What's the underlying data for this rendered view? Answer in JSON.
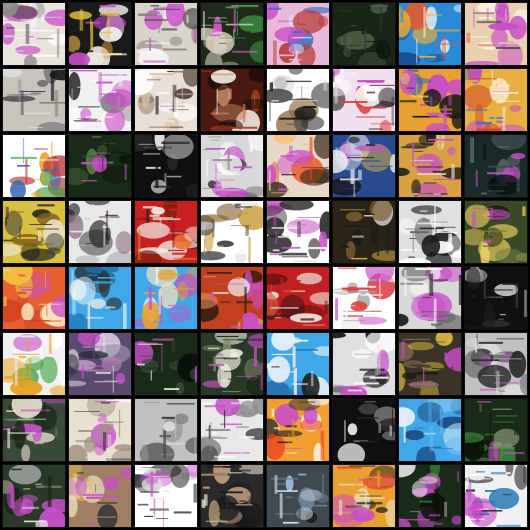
{
  "image_grid": {
    "rows": 8,
    "columns": 8,
    "tiles": [
      {
        "palette": [
          "#e8e4dc",
          "#c84ec8",
          "#2b2b2b",
          "#8c8c8c",
          "#ffffff"
        ],
        "style": "doc"
      },
      {
        "palette": [
          "#1a1a1a",
          "#e6c23a",
          "#c84ec8",
          "#d9a040",
          "#f2f2f2"
        ],
        "style": "burst"
      },
      {
        "palette": [
          "#d8d4cc",
          "#c84ec8",
          "#3a3a3a",
          "#8a8070",
          "#f5f5f5"
        ],
        "style": "doc"
      },
      {
        "palette": [
          "#1f2a1a",
          "#e85ad8",
          "#40a048",
          "#d8d0c0",
          "#a0a090"
        ],
        "style": "doc"
      },
      {
        "palette": [
          "#e8b8d8",
          "#c84ec8",
          "#3a70c0",
          "#e0e0f0",
          "#b84040"
        ],
        "style": "burst"
      },
      {
        "palette": [
          "#1a2418",
          "#2a3a28",
          "#3a4a38",
          "#101810",
          "#506048"
        ],
        "style": "dark"
      },
      {
        "palette": [
          "#2a8ad8",
          "#e85a2a",
          "#ffffff",
          "#f0b030",
          "#1a4a90"
        ],
        "style": "sky"
      },
      {
        "palette": [
          "#e8d0b0",
          "#c84ec8",
          "#e86030",
          "#3a3a3a",
          "#f8f0e0"
        ],
        "style": "burst"
      },
      {
        "palette": [
          "#c8c4bc",
          "#1a1a1a",
          "#8a8a8a",
          "#e0e0e0",
          "#505050"
        ],
        "style": "dark"
      },
      {
        "palette": [
          "#f0f0f0",
          "#2a2a2a",
          "#c84ec8",
          "#a0a0a0",
          "#ffffff"
        ],
        "style": "doc"
      },
      {
        "palette": [
          "#e8e0d8",
          "#3a2a2a",
          "#d8c0a0",
          "#8a7060",
          "#ffffff"
        ],
        "style": "doc"
      },
      {
        "palette": [
          "#4a1a10",
          "#f0e8e0",
          "#a04020",
          "#1a0a08",
          "#c08060"
        ],
        "style": "burst"
      },
      {
        "palette": [
          "#ffffff",
          "#1a1a1a",
          "#8a6a40",
          "#e0e0e0",
          "#3a3a3a"
        ],
        "style": "burst"
      },
      {
        "palette": [
          "#f0e0f0",
          "#c84ec8",
          "#e04040",
          "#2a2a2a",
          "#ffffff"
        ],
        "style": "doc"
      },
      {
        "palette": [
          "#e8a030",
          "#c84ec8",
          "#3a6ab0",
          "#f0d070",
          "#1a1a1a"
        ],
        "style": "doc"
      },
      {
        "palette": [
          "#e8b040",
          "#c84ec8",
          "#3a70c0",
          "#ffffff",
          "#d04020"
        ],
        "style": "doc"
      },
      {
        "palette": [
          "#ffffff",
          "#e8a020",
          "#40a040",
          "#c04040",
          "#3a6ab0"
        ],
        "style": "sky"
      },
      {
        "palette": [
          "#1a2a18",
          "#3a5a30",
          "#c84ec8",
          "#0a1408",
          "#608050"
        ],
        "style": "dark"
      },
      {
        "palette": [
          "#101010",
          "#e8e8e8",
          "#4a4a4a",
          "#2a2a2a",
          "#8a8a8a"
        ],
        "style": "dark"
      },
      {
        "palette": [
          "#d8d8d8",
          "#c84ec8",
          "#3a3a3a",
          "#ffffff",
          "#8a8a8a"
        ],
        "style": "doc"
      },
      {
        "palette": [
          "#e8d8c8",
          "#e85a2a",
          "#c84ec8",
          "#3a2a1a",
          "#f8c070"
        ],
        "style": "burst"
      },
      {
        "palette": [
          "#2a4a90",
          "#f0f0f0",
          "#e8c040",
          "#101820",
          "#c84ec8"
        ],
        "style": "burst"
      },
      {
        "palette": [
          "#d8a040",
          "#c84ec8",
          "#3a3a3a",
          "#f0e0c0",
          "#1a1a1a"
        ],
        "style": "doc"
      },
      {
        "palette": [
          "#1a2a28",
          "#3a4a48",
          "#c84ec8",
          "#0a1010",
          "#607070"
        ],
        "style": "dark"
      },
      {
        "palette": [
          "#d8c040",
          "#1a1a1a",
          "#e8e0c0",
          "#806020",
          "#3a3a3a"
        ],
        "style": "burst"
      },
      {
        "palette": [
          "#e8e8e8",
          "#1a1a1a",
          "#8a6a80",
          "#c0c0c0",
          "#3a3a3a"
        ],
        "style": "burst"
      },
      {
        "palette": [
          "#c82020",
          "#f0e8e0",
          "#1a1a1a",
          "#e87030",
          "#802010"
        ],
        "style": "doc"
      },
      {
        "palette": [
          "#ffffff",
          "#c8a040",
          "#3a3a3a",
          "#e0e0e0",
          "#806040"
        ],
        "style": "burst"
      },
      {
        "palette": [
          "#ffffff",
          "#c84ec8",
          "#2a2a2a",
          "#e0e0e0",
          "#6a6a6a"
        ],
        "style": "doc"
      },
      {
        "palette": [
          "#2a2418",
          "#c8a040",
          "#ffffff",
          "#1a1a1a",
          "#806030"
        ],
        "style": "dark"
      },
      {
        "palette": [
          "#e0e0e0",
          "#1a1a1a",
          "#4a4a4a",
          "#ffffff",
          "#8a8a8a"
        ],
        "style": "doc"
      },
      {
        "palette": [
          "#3a4a28",
          "#c84ec8",
          "#e8d060",
          "#1a2010",
          "#708040"
        ],
        "style": "burst"
      },
      {
        "palette": [
          "#e86030",
          "#f0c040",
          "#c84ec8",
          "#d04020",
          "#f8e8c0"
        ],
        "style": "burst"
      },
      {
        "palette": [
          "#40a8e8",
          "#ffffff",
          "#2a2a2a",
          "#e8e8e8",
          "#1a70b0"
        ],
        "style": "sky"
      },
      {
        "palette": [
          "#40a8e8",
          "#f0e0c0",
          "#c84ec8",
          "#e8a030",
          "#ffffff"
        ],
        "style": "sky"
      },
      {
        "palette": [
          "#c04020",
          "#c84ec8",
          "#2a1a10",
          "#e8a060",
          "#f0f0f0"
        ],
        "style": "burst"
      },
      {
        "palette": [
          "#c02020",
          "#1a1a1a",
          "#f0e8e0",
          "#e86040",
          "#601010"
        ],
        "style": "burst"
      },
      {
        "palette": [
          "#ffffff",
          "#c84ec8",
          "#e04040",
          "#f0f0f0",
          "#a0a0a0"
        ],
        "style": "doc"
      },
      {
        "palette": [
          "#d8d8d8",
          "#1a1a1a",
          "#c84ec8",
          "#5a5a5a",
          "#ffffff"
        ],
        "style": "doc"
      },
      {
        "palette": [
          "#101010",
          "#f0f0f0",
          "#4a4a4a",
          "#202020",
          "#a0a0a0"
        ],
        "style": "dark"
      },
      {
        "palette": [
          "#f0f0f0",
          "#e8a020",
          "#40a040",
          "#c84ec8",
          "#ffffff"
        ],
        "style": "sky"
      },
      {
        "palette": [
          "#5a4a70",
          "#c84ec8",
          "#e8d8e8",
          "#2a2a3a",
          "#a090b0"
        ],
        "style": "doc"
      },
      {
        "palette": [
          "#1a2a18",
          "#3a4a38",
          "#c84ec8",
          "#0a1008",
          "#f0f0f0"
        ],
        "style": "dark"
      },
      {
        "palette": [
          "#2a3a28",
          "#f0f0e0",
          "#c84ec8",
          "#1a2418",
          "#8a9070"
        ],
        "style": "doc"
      },
      {
        "palette": [
          "#40a8e8",
          "#1a1a1a",
          "#e8f0f8",
          "#2a70b0",
          "#ffffff"
        ],
        "style": "sky"
      },
      {
        "palette": [
          "#e0e0e0",
          "#c84ec8",
          "#1a1a1a",
          "#a0a0a0",
          "#ffffff"
        ],
        "style": "burst"
      },
      {
        "palette": [
          "#3a3428",
          "#c84ec8",
          "#e8c040",
          "#1a1a10",
          "#807050"
        ],
        "style": "burst"
      },
      {
        "palette": [
          "#c0c0c0",
          "#c84ec8",
          "#2a2a2a",
          "#e0e0e0",
          "#6a6a6a"
        ],
        "style": "doc"
      },
      {
        "palette": [
          "#3a4a38",
          "#c84ec8",
          "#e8e0d0",
          "#1a2418",
          "#809070"
        ],
        "style": "burst"
      },
      {
        "palette": [
          "#e8e0d0",
          "#c84ec8",
          "#3a3a3a",
          "#a09080",
          "#ffffff"
        ],
        "style": "doc"
      },
      {
        "palette": [
          "#c0c0c0",
          "#1a1a1a",
          "#e8e8e8",
          "#4a4a4a",
          "#8a8a8a"
        ],
        "style": "dark"
      },
      {
        "palette": [
          "#e8e8e8",
          "#c84ec8",
          "#2a2a2a",
          "#ffffff",
          "#8a8a8a"
        ],
        "style": "doc"
      },
      {
        "palette": [
          "#f0a030",
          "#c84ec8",
          "#e84020",
          "#ffffff",
          "#2a2a2a"
        ],
        "style": "burst"
      },
      {
        "palette": [
          "#101010",
          "#f0f0f0",
          "#2a2a2a",
          "#6a6a6a",
          "#c0c0c0"
        ],
        "style": "dark"
      },
      {
        "palette": [
          "#40a8e8",
          "#2a70b0",
          "#e8f0f8",
          "#1a4a80",
          "#70c0f0"
        ],
        "style": "sky"
      },
      {
        "palette": [
          "#1a2a18",
          "#c84ec8",
          "#40a040",
          "#0a1008",
          "#809070"
        ],
        "style": "burst"
      },
      {
        "palette": [
          "#2a3a28",
          "#c84ec8",
          "#f0f0f0",
          "#1a2418",
          "#8a9070"
        ],
        "style": "burst"
      },
      {
        "palette": [
          "#a08060",
          "#e8c040",
          "#3a3a3a",
          "#c84ec8",
          "#f0e0c0"
        ],
        "style": "burst"
      },
      {
        "palette": [
          "#ffffff",
          "#1a1a1a",
          "#c84ec8",
          "#e0e0e0",
          "#5a5a5a"
        ],
        "style": "doc"
      },
      {
        "palette": [
          "#2a2a2a",
          "#e8e0d0",
          "#8a7060",
          "#1a1a1a",
          "#c0a080"
        ],
        "style": "doc"
      },
      {
        "palette": [
          "#404850",
          "#a0c0e0",
          "#1a1a1a",
          "#e0e8f0",
          "#6a8090"
        ],
        "style": "dark"
      },
      {
        "palette": [
          "#e8a030",
          "#c84ec8",
          "#2a2a2a",
          "#f0e0c0",
          "#e84020"
        ],
        "style": "doc"
      },
      {
        "palette": [
          "#1a2a18",
          "#40a040",
          "#c84ec8",
          "#e8e8e8",
          "#0a1008"
        ],
        "style": "burst"
      },
      {
        "palette": [
          "#f0f0f0",
          "#c84ec8",
          "#2a2a2a",
          "#1a70b0",
          "#ffffff"
        ],
        "style": "doc"
      }
    ]
  }
}
